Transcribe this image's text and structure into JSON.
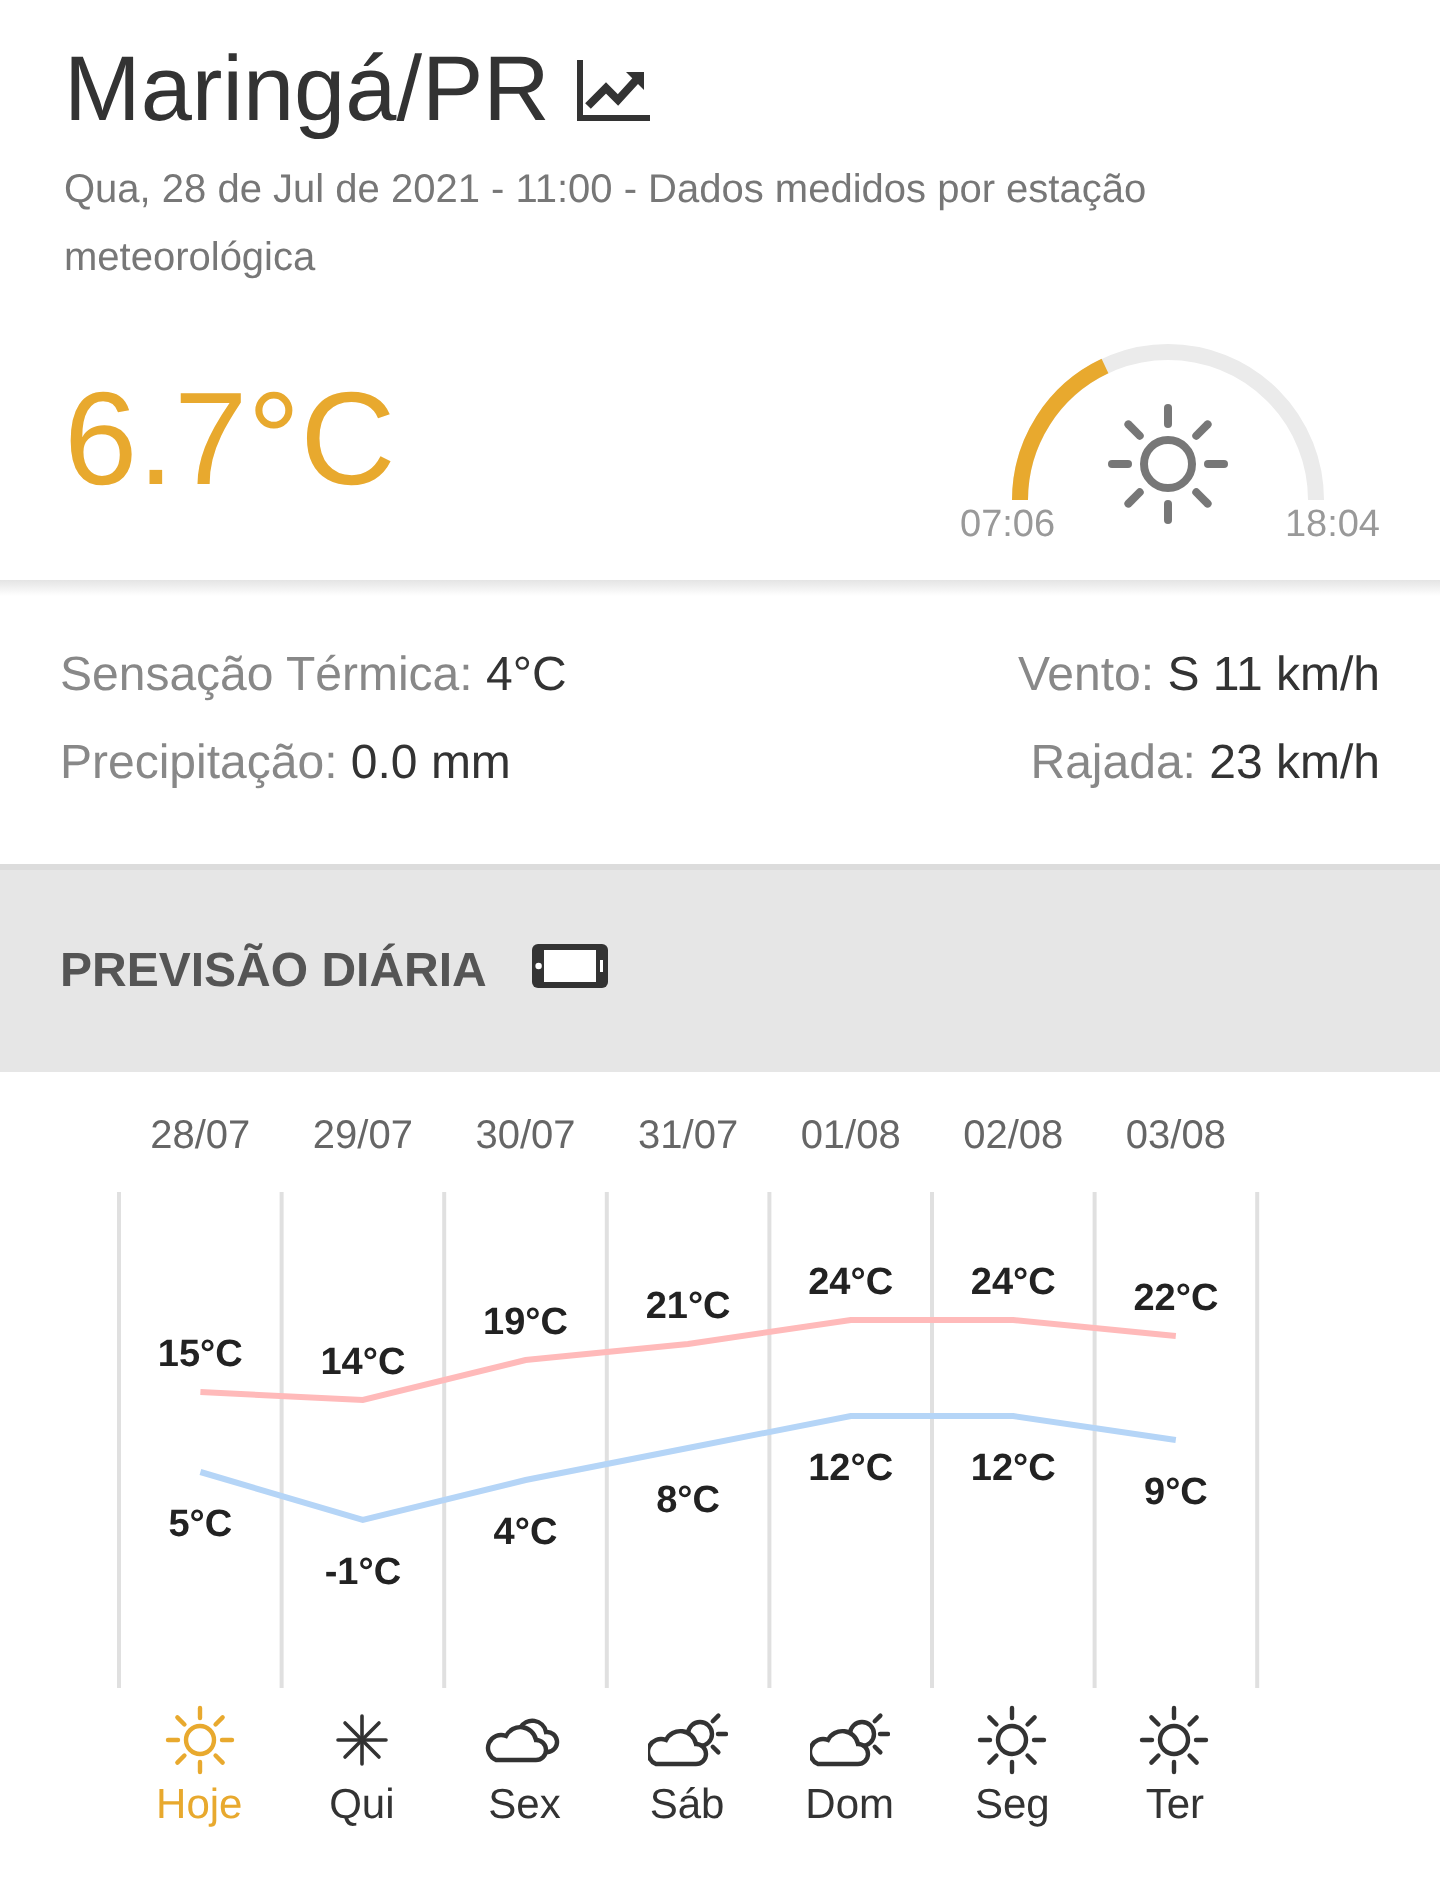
{
  "header": {
    "city": "Maringá/PR",
    "subtitle": "Qua, 28 de Jul de 2021 - 11:00 - Dados medidos por estação meteorológica"
  },
  "current": {
    "temperature": "6.7°C",
    "sun": {
      "sunrise": "07:06",
      "sunset": "18:04"
    }
  },
  "details": [
    {
      "label": "Sensação Térmica:",
      "value": "4°C"
    },
    {
      "label": "Vento:",
      "value": "S 11 km/h"
    },
    {
      "label": "Precipitação:",
      "value": "0.0 mm"
    },
    {
      "label": "Rajada:",
      "value": "23 km/h"
    }
  ],
  "forecast": {
    "title": "PREVISÃO DIÁRIA",
    "chart_data": {
      "type": "line",
      "categories": [
        "28/07",
        "29/07",
        "30/07",
        "31/07",
        "01/08",
        "02/08",
        "03/08"
      ],
      "series": [
        {
          "color": "#ffbaba",
          "values": [
            15,
            14,
            19,
            21,
            24,
            24,
            22
          ],
          "value_labels": [
            "15°C",
            "14°C",
            "19°C",
            "21°C",
            "24°C",
            "24°C",
            "22°C"
          ]
        },
        {
          "color": "#b5d5f7",
          "values": [
            5,
            -1,
            4,
            8,
            12,
            12,
            9
          ],
          "value_labels": [
            "5°C",
            "-1°C",
            "4°C",
            "8°C",
            "12°C",
            "12°C",
            "9°C"
          ]
        }
      ]
    },
    "days": [
      {
        "label": "Hoje",
        "kind": "sun",
        "selected": true
      },
      {
        "label": "Qui",
        "kind": "frost",
        "selected": false
      },
      {
        "label": "Sex",
        "kind": "cloud",
        "selected": false
      },
      {
        "label": "Sáb",
        "kind": "partly",
        "selected": false
      },
      {
        "label": "Dom",
        "kind": "partly",
        "selected": false
      },
      {
        "label": "Seg",
        "kind": "sun",
        "selected": false
      },
      {
        "label": "Ter",
        "kind": "sun",
        "selected": false
      }
    ]
  }
}
